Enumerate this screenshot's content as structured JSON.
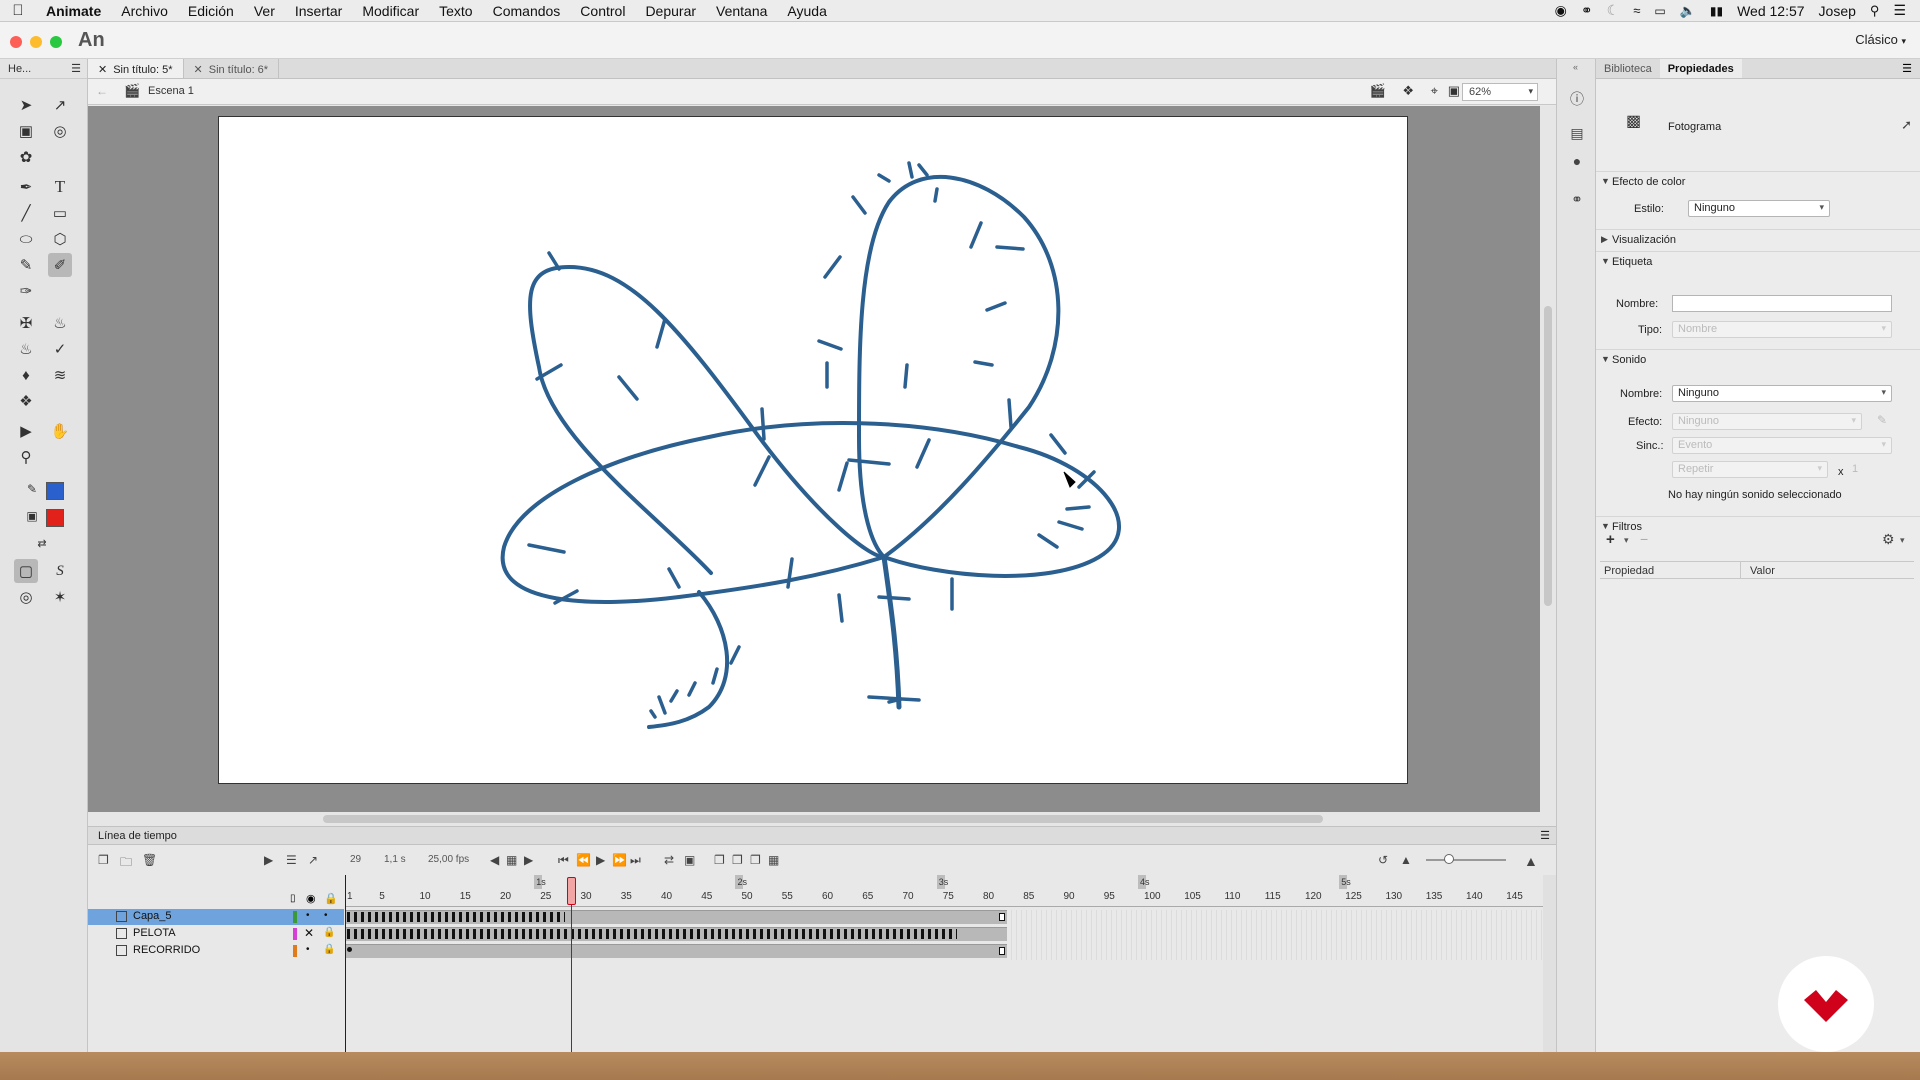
{
  "menubar": {
    "app": "Animate",
    "items": [
      "Archivo",
      "Edición",
      "Ver",
      "Insertar",
      "Modificar",
      "Texto",
      "Comandos",
      "Control",
      "Depurar",
      "Ventana",
      "Ayuda"
    ],
    "clock": "Wed 12:57",
    "user": "Josep"
  },
  "window": {
    "app_logo": "An",
    "workspace": "Clásico"
  },
  "tools": {
    "panel_label": "He...",
    "stroke_color": "#2a5fce",
    "fill_color": "#e3211b"
  },
  "documents": {
    "tabs": [
      "Sin título: 5*",
      "Sin título: 6*"
    ]
  },
  "editbar": {
    "scene": "Escena 1",
    "zoom": "62%"
  },
  "stage": {
    "stroke_color": "#2a5f8f"
  },
  "props": {
    "tabs": [
      "Biblioteca",
      "Propiedades"
    ],
    "object_type": "Fotograma",
    "color_effect": {
      "title": "Efecto de color",
      "style_label": "Estilo:",
      "style_value": "Ninguno"
    },
    "display": {
      "title": "Visualización"
    },
    "label": {
      "title": "Etiqueta",
      "name_label": "Nombre:",
      "name_value": "",
      "type_label": "Tipo:",
      "type_value": "Nombre"
    },
    "sound": {
      "title": "Sonido",
      "name_label": "Nombre:",
      "name_value": "Ninguno",
      "effect_label": "Efecto:",
      "effect_value": "Ninguno",
      "sync_label": "Sinc.:",
      "sync_value": "Evento",
      "repeat_value": "Repetir",
      "repeat_x": "x",
      "repeat_count": "1",
      "empty_msg": "No hay ningún sonido seleccionado"
    },
    "filters": {
      "title": "Filtros",
      "col_property": "Propiedad",
      "col_value": "Valor"
    }
  },
  "timeline": {
    "title": "Línea de tiempo",
    "current_frame": "29",
    "time": "1,1 s",
    "fps": "25,00 fps",
    "ruler_frames": [
      "1",
      "5",
      "10",
      "15",
      "20",
      "25",
      "30",
      "35",
      "40",
      "45",
      "50",
      "55",
      "60",
      "65",
      "70",
      "75",
      "80",
      "85",
      "90",
      "95",
      "100",
      "105",
      "110",
      "115",
      "120",
      "125",
      "130",
      "135",
      "140",
      "145"
    ],
    "second_marks": [
      "1s",
      "2s",
      "3s",
      "4s",
      "5s"
    ],
    "layers": [
      {
        "name": "Capa_5",
        "color": "#3a9a3a",
        "selected": true
      },
      {
        "name": "PELOTA",
        "color": "#d63fd6",
        "selected": false
      },
      {
        "name": "RECORRIDO",
        "color": "#e07a1a",
        "selected": false
      }
    ]
  },
  "brand": {
    "color": "#d0021b"
  }
}
